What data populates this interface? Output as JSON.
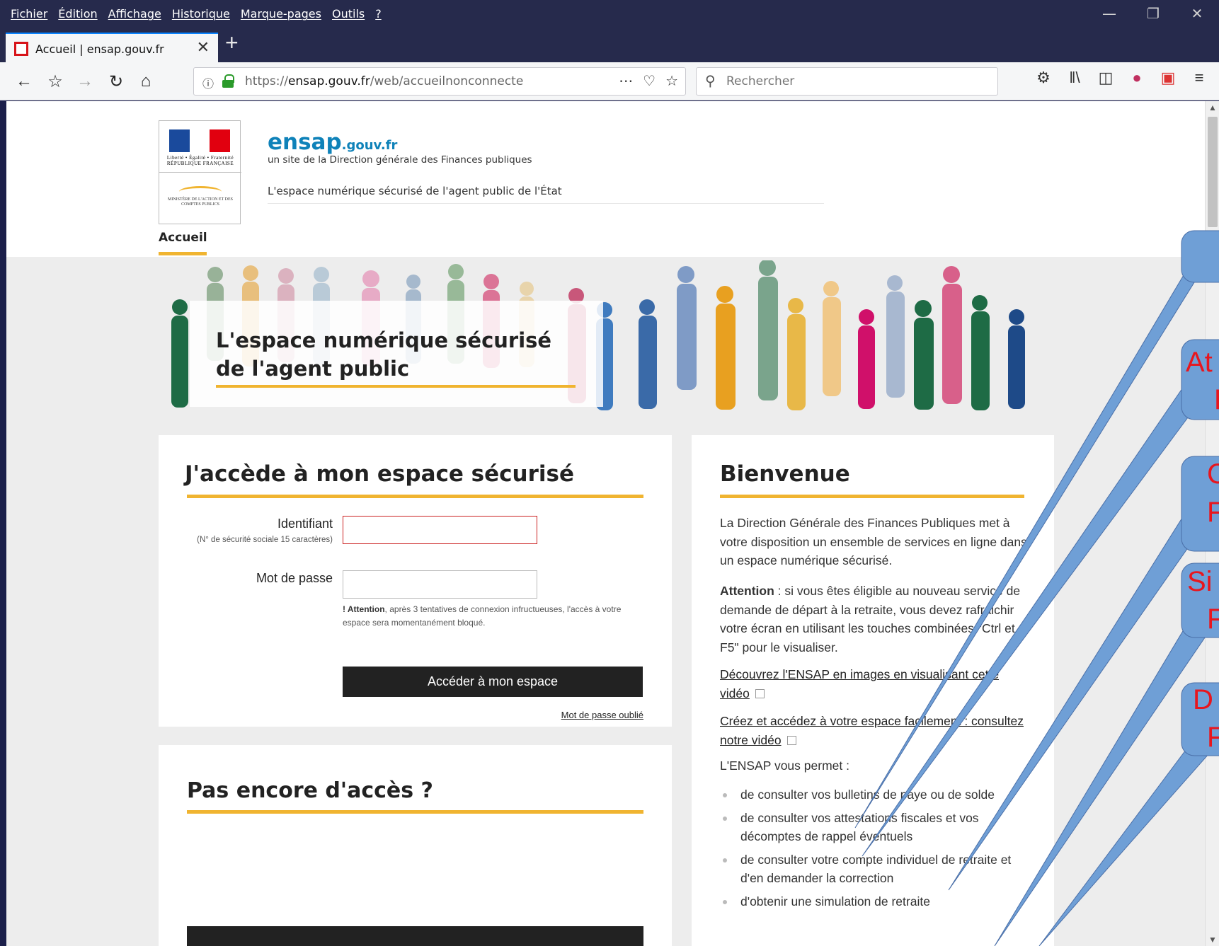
{
  "browser": {
    "menu": [
      "Fichier",
      "Édition",
      "Affichage",
      "Historique",
      "Marque-pages",
      "Outils",
      "?"
    ],
    "tab_title": "Accueil | ensap.gouv.fr",
    "url_prefix": "https://",
    "url_domain": "ensap.gouv.fr",
    "url_path": "/web/accueilnonconnecte",
    "search_placeholder": "Rechercher"
  },
  "header": {
    "logo_rf": "Liberté • Égalité • Fraternité  RÉPUBLIQUE FRANÇAISE",
    "logo_ministry": "MINISTÈRE DE L'ACTION ET DES COMPTES PUBLICS",
    "brand": "ensap",
    "brand_suffix": ".gouv.fr",
    "subtitle": "un site de la Direction générale des Finances publiques",
    "tagline": "L'espace numérique sécurisé de l'agent public de l'État"
  },
  "nav": {
    "accueil": "Accueil"
  },
  "banner": {
    "title_line1": "L'espace numérique sécurisé",
    "title_line2": "de l'agent public"
  },
  "login": {
    "title": "J'accède à mon espace sécurisé",
    "identifiant_label": "Identifiant",
    "identifiant_hint": "(N° de sécurité sociale 15 caractères)",
    "password_label": "Mot de passe",
    "warning_bold": "! Attention",
    "warning_text": ", après 3 tentatives de connexion infructueuses, l'accès à votre espace sera momentanément bloqué.",
    "submit": "Accéder à mon espace",
    "forgot": "Mot de passe oublié"
  },
  "pas_encore": {
    "title": "Pas encore d'accès ?"
  },
  "welcome": {
    "title": "Bienvenue",
    "intro": "La Direction Générale des Finances Publiques met à votre disposition un ensemble de services en ligne dans un espace numérique sécurisé.",
    "attention_bold": "Attention",
    "attention_text": " : si vous êtes éligible au nouveau service de demande de départ à la retraite, vous devez rafraichir votre écran en utilisant les touches combinées  \"Ctrl et F5\" pour le visualiser.",
    "link1": "Découvrez l'ENSAP en images en visualisant cette vidéo",
    "link2": "Créez et accédez à votre espace facilement : consultez notre vidéo",
    "permet": "L'ENSAP vous permet :",
    "items": [
      "de consulter vos bulletins de paye ou de solde",
      "de consulter vos attestations fiscales et vos décomptes de rappel éventuels",
      "de consulter votre compte individuel de retraite et d'en demander la correction",
      "d'obtenir une simulation de retraite"
    ]
  },
  "callouts": [
    "At",
    "F",
    "C",
    "F",
    "Si",
    "F",
    "D",
    "F"
  ],
  "colors": {
    "accent_yellow": "#f0b430",
    "brand_blue": "#0f82b9",
    "callout_blue": "#6f9fd6",
    "callout_red": "#e8161e"
  }
}
